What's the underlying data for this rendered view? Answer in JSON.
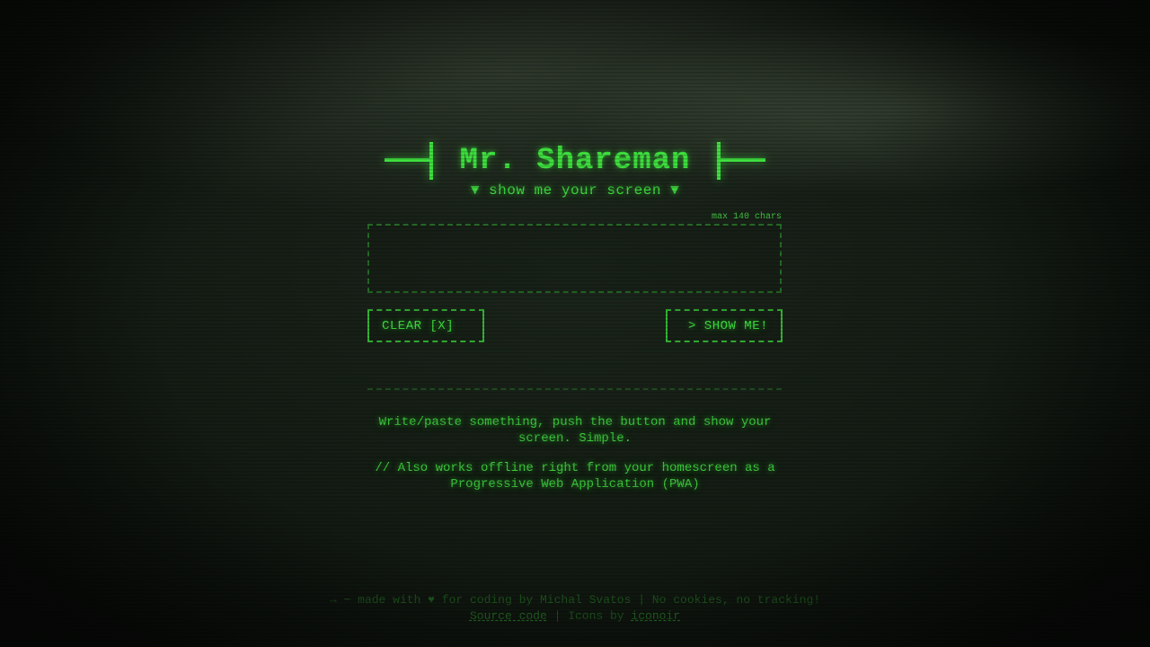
{
  "header": {
    "title": "Mr. Shareman",
    "subtitle": "▼ show me your screen ▼"
  },
  "composer": {
    "counter": "max 140 chars",
    "value": "",
    "placeholder": ""
  },
  "buttons": {
    "clear_label": "CLEAR [X]",
    "show_label": "> SHOW ME!"
  },
  "info": {
    "line1": "Write/paste something, push the button and show your screen. Simple.",
    "line2": "// Also works offline right from your homescreen as a Progressive Web Application (PWA)"
  },
  "footer": {
    "made_with": "→ ~ made with ♥ for coding by Michal Svatos | No cookies, no tracking!",
    "source_link": "Source code",
    "separator": " | Icons by ",
    "icons_link": "iconoir"
  },
  "colors": {
    "accent": "#3fe03f",
    "background": "#141c14",
    "muted": "#1f5a1f"
  }
}
